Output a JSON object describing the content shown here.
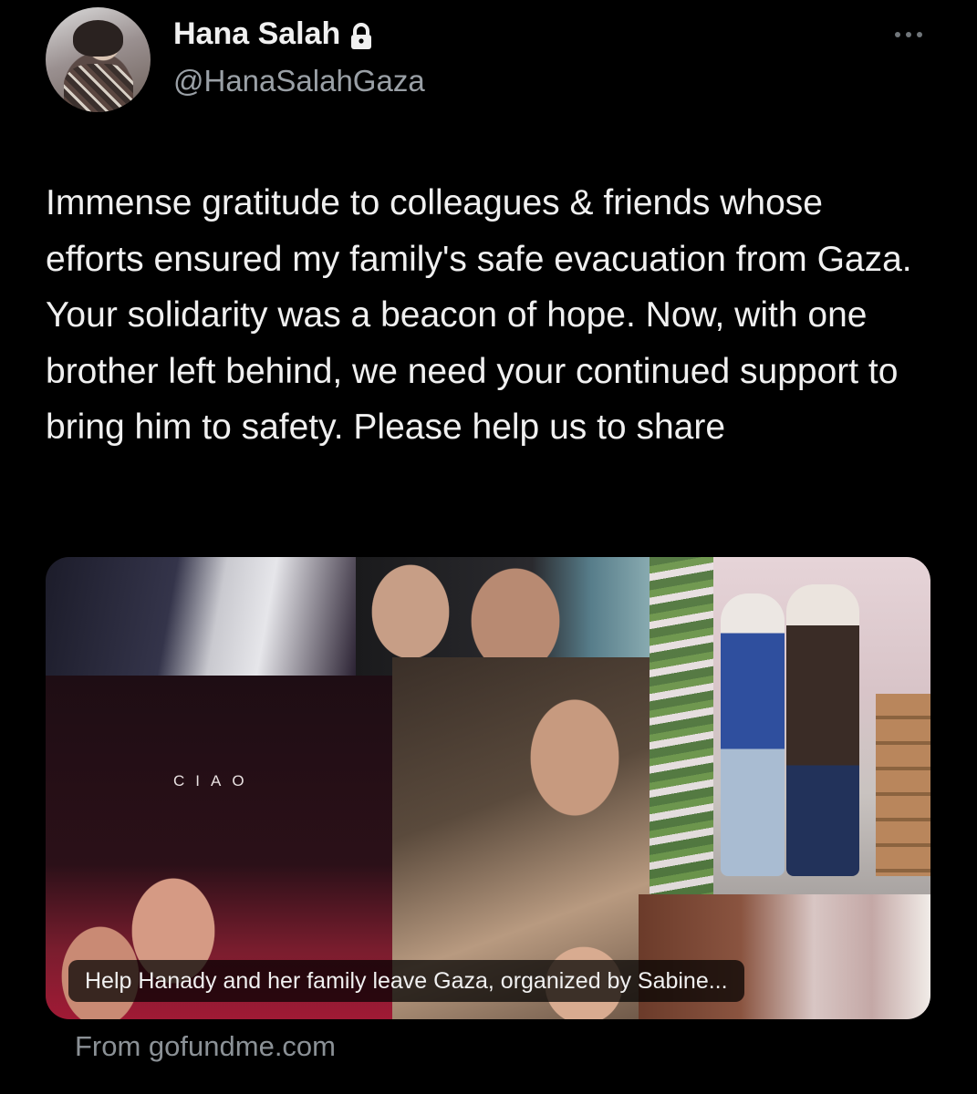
{
  "author": {
    "display_name": "Hana Salah",
    "handle": "@HanaSalahGaza",
    "protected": true,
    "avatar_icon": "profile-photo"
  },
  "tweet": {
    "text": "Immense gratitude to colleagues & friends whose efforts ensured my family's safe evacuation from Gaza. Your solidarity was a beacon of hope. Now, with one brother left behind, we need your continued support to bring him to safety. Please help us to share"
  },
  "link_card": {
    "image_text": "CIAO",
    "caption": "Help Hanady and her family leave Gaza, organized by Sabine...",
    "source": "From gofundme.com"
  },
  "colors": {
    "background": "#000000",
    "text": "#e7e9ea",
    "secondary_text": "#71767b"
  }
}
